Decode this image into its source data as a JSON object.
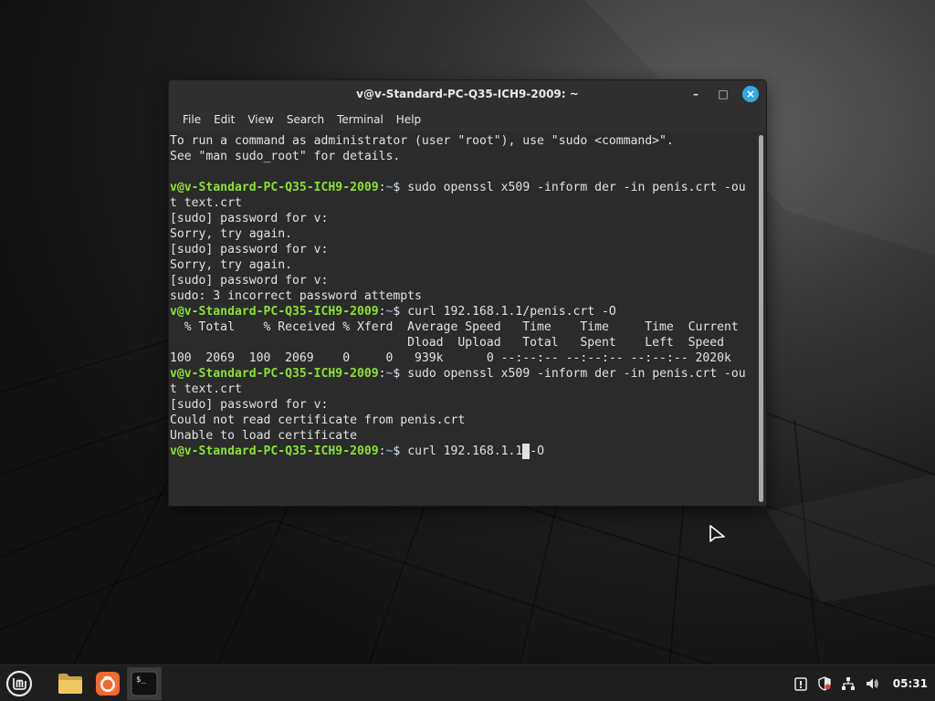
{
  "window": {
    "title": "v@v-Standard-PC-Q35-ICH9-2009: ~",
    "minimize_glyph": "–",
    "maximize_glyph": "□",
    "close_glyph": "×"
  },
  "menu": [
    "File",
    "Edit",
    "View",
    "Search",
    "Terminal",
    "Help"
  ],
  "prompt": {
    "user": "v@v-Standard-PC-Q35-ICH9-2009",
    "sep": ":",
    "path": "~",
    "symbol": "$ "
  },
  "terminal_lines": [
    {
      "type": "text",
      "text": "To run a command as administrator (user \"root\"), use \"sudo <command>\"."
    },
    {
      "type": "text",
      "text": "See \"man sudo_root\" for details."
    },
    {
      "type": "text",
      "text": ""
    },
    {
      "type": "prompt",
      "cmd": "sudo openssl x509 -inform der -in penis.crt -ou"
    },
    {
      "type": "text",
      "text": "t text.crt"
    },
    {
      "type": "text",
      "text": "[sudo] password for v:"
    },
    {
      "type": "text",
      "text": "Sorry, try again."
    },
    {
      "type": "text",
      "text": "[sudo] password for v:"
    },
    {
      "type": "text",
      "text": "Sorry, try again."
    },
    {
      "type": "text",
      "text": "[sudo] password for v:"
    },
    {
      "type": "text",
      "text": "sudo: 3 incorrect password attempts"
    },
    {
      "type": "prompt",
      "cmd": "curl 192.168.1.1/penis.crt -O"
    },
    {
      "type": "text",
      "text": "  % Total    % Received % Xferd  Average Speed   Time    Time     Time  Current"
    },
    {
      "type": "text",
      "text": "                                 Dload  Upload   Total   Spent    Left  Speed"
    },
    {
      "type": "text",
      "text": "100  2069  100  2069    0     0   939k      0 --:--:-- --:--:-- --:--:-- 2020k"
    },
    {
      "type": "prompt",
      "cmd": "sudo openssl x509 -inform der -in penis.crt -ou"
    },
    {
      "type": "text",
      "text": "t text.crt"
    },
    {
      "type": "text",
      "text": "[sudo] password for v:"
    },
    {
      "type": "text",
      "text": "Could not read certificate from penis.crt"
    },
    {
      "type": "text",
      "text": "Unable to load certificate"
    },
    {
      "type": "prompt_cursor",
      "before": "curl 192.168.1.1",
      "cursor_char": " ",
      "after": "-O"
    }
  ],
  "taskbar": {
    "menu_icon": "linux-mint-icon",
    "apps": [
      "files-folder-icon",
      "firefox-icon",
      "terminal-icon"
    ],
    "terminal_icon_text": "$_",
    "clock": "05:31"
  },
  "tray": [
    "update-manager-icon",
    "shield-icon",
    "network-icon",
    "volume-icon"
  ]
}
